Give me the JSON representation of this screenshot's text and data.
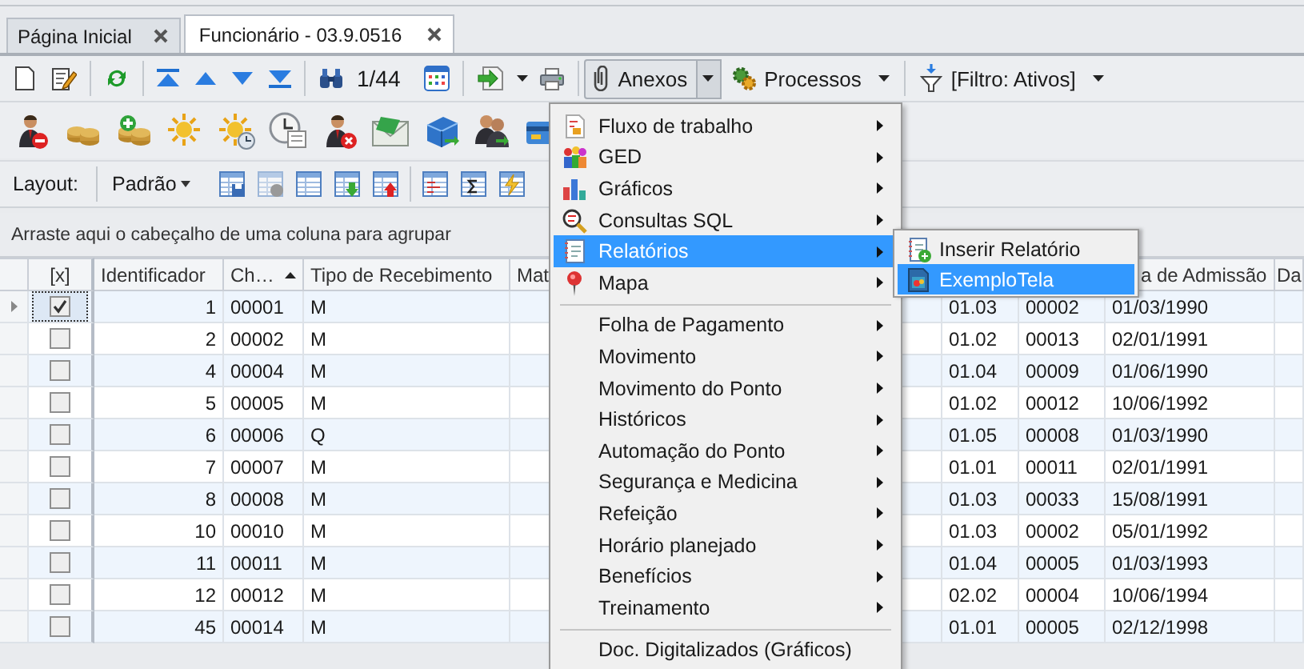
{
  "tabs": [
    {
      "label": "Página Inicial",
      "selected": false
    },
    {
      "label": "Funcionário - 03.9.0516",
      "selected": true
    }
  ],
  "toolbar": {
    "record_position": "1/44",
    "attachments_button": "Anexos",
    "attachments_pressed": true,
    "processes_button": "Processos",
    "filter_button": "[Filtro: Ativos]"
  },
  "layout_bar": {
    "label": "Layout:",
    "layout_name": "Padrão"
  },
  "group_panel": {
    "hint": "Arraste aqui o cabeçalho de uma coluna para agrupar"
  },
  "grid": {
    "columns": [
      {
        "label": "[x]"
      },
      {
        "label": "Identificador"
      },
      {
        "label": "Ch…",
        "sorted": true
      },
      {
        "label": "Tipo de Recebimento"
      },
      {
        "label": "Mat"
      },
      {},
      {},
      {
        "label": "a de Admissão"
      },
      {
        "label": "Da"
      }
    ],
    "rows": [
      {
        "current": true,
        "checked": true,
        "identificador": "1",
        "ch": "00001",
        "tipo": "M",
        "column_6": "01.03",
        "column_7": "00002",
        "admissao": "01/03/1990"
      },
      {
        "current": false,
        "checked": false,
        "identificador": "2",
        "ch": "00002",
        "tipo": "M",
        "column_6": "01.02",
        "column_7": "00013",
        "admissao": "02/01/1991"
      },
      {
        "current": false,
        "checked": false,
        "identificador": "4",
        "ch": "00004",
        "tipo": "M",
        "column_6": "01.04",
        "column_7": "00009",
        "admissao": "01/06/1990"
      },
      {
        "current": false,
        "checked": false,
        "identificador": "5",
        "ch": "00005",
        "tipo": "M",
        "column_6": "01.02",
        "column_7": "00012",
        "admissao": "10/06/1992"
      },
      {
        "current": false,
        "checked": false,
        "identificador": "6",
        "ch": "00006",
        "tipo": "Q",
        "column_6": "01.05",
        "column_7": "00008",
        "admissao": "01/03/1990"
      },
      {
        "current": false,
        "checked": false,
        "identificador": "7",
        "ch": "00007",
        "tipo": "M",
        "column_6": "01.01",
        "column_7": "00011",
        "admissao": "02/01/1991"
      },
      {
        "current": false,
        "checked": false,
        "identificador": "8",
        "ch": "00008",
        "tipo": "M",
        "column_6": "01.03",
        "column_7": "00033",
        "admissao": "15/08/1991"
      },
      {
        "current": false,
        "checked": false,
        "identificador": "10",
        "ch": "00010",
        "tipo": "M",
        "column_6": "01.03",
        "column_7": "00002",
        "admissao": "05/01/1992"
      },
      {
        "current": false,
        "checked": false,
        "identificador": "11",
        "ch": "00011",
        "tipo": "M",
        "column_6": "01.04",
        "column_7": "00005",
        "admissao": "01/03/1993"
      },
      {
        "current": false,
        "checked": false,
        "identificador": "12",
        "ch": "00012",
        "tipo": "M",
        "column_6": "02.02",
        "column_7": "00004",
        "admissao": "10/06/1994"
      },
      {
        "current": false,
        "checked": false,
        "identificador": "45",
        "ch": "00014",
        "tipo": "M",
        "column_6": "01.01",
        "column_7": "00005",
        "admissao": "02/12/1998"
      }
    ]
  },
  "attachments_menu": {
    "items": [
      {
        "kind": "item",
        "label": "Fluxo de trabalho",
        "submenu": true,
        "selected": false
      },
      {
        "kind": "item",
        "label": "GED",
        "submenu": true,
        "selected": false
      },
      {
        "kind": "item",
        "label": "Gráficos",
        "submenu": true,
        "selected": false
      },
      {
        "kind": "item",
        "label": "Consultas SQL",
        "submenu": true,
        "selected": false
      },
      {
        "kind": "item",
        "label": "Relatórios",
        "submenu": true,
        "selected": true
      },
      {
        "kind": "item",
        "label": "Mapa",
        "submenu": true,
        "selected": false
      },
      {
        "kind": "separator"
      },
      {
        "kind": "item",
        "label": "Folha de Pagamento",
        "submenu": true,
        "selected": false
      },
      {
        "kind": "item",
        "label": "Movimento",
        "submenu": true,
        "selected": false
      },
      {
        "kind": "item",
        "label": "Movimento do Ponto",
        "submenu": true,
        "selected": false
      },
      {
        "kind": "item",
        "label": "Históricos",
        "submenu": true,
        "selected": false
      },
      {
        "kind": "item",
        "label": "Automação do Ponto",
        "submenu": true,
        "selected": false
      },
      {
        "kind": "item",
        "label": "Segurança e Medicina",
        "submenu": true,
        "selected": false
      },
      {
        "kind": "item",
        "label": "Refeição",
        "submenu": true,
        "selected": false
      },
      {
        "kind": "item",
        "label": "Horário planejado",
        "submenu": true,
        "selected": false
      },
      {
        "kind": "item",
        "label": "Benefícios",
        "submenu": true,
        "selected": false
      },
      {
        "kind": "item",
        "label": "Treinamento",
        "submenu": true,
        "selected": false
      },
      {
        "kind": "separator"
      },
      {
        "kind": "item",
        "label": "Doc. Digitalizados (Gráficos)",
        "submenu": false,
        "selected": false
      }
    ]
  },
  "reports_submenu": {
    "items": [
      {
        "label": "Inserir Relatório",
        "selected": false
      },
      {
        "label": "ExemploTela",
        "selected": true
      }
    ]
  }
}
